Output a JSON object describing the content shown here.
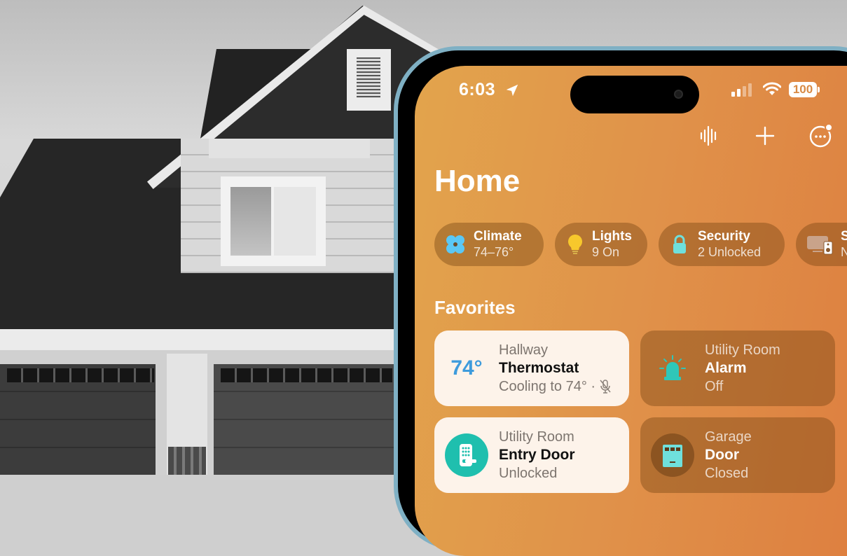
{
  "status_bar": {
    "time": "6:03",
    "battery": "100",
    "icons": [
      "location-arrow-icon",
      "cellular-signal-icon",
      "wifi-icon",
      "battery-icon"
    ]
  },
  "toolbar": {
    "icons": [
      "voice-waveform-icon",
      "add-icon",
      "more-options-icon"
    ]
  },
  "page": {
    "title": "Home"
  },
  "categories": [
    {
      "icon": "fan-icon",
      "label": "Climate",
      "value": "74–76°"
    },
    {
      "icon": "lightbulb-icon",
      "label": "Lights",
      "value": "9 On"
    },
    {
      "icon": "lock-icon",
      "label": "Security",
      "value": "2 Unlocked"
    },
    {
      "icon": "speaker-tv-icon",
      "label": "S",
      "value": "N"
    }
  ],
  "favorites": {
    "heading": "Favorites",
    "tiles": [
      {
        "lead": "74°",
        "room": "Hallway",
        "name": "Thermostat",
        "state": "Cooling to 74° ·",
        "icon": "mic-off-icon",
        "style": "light"
      },
      {
        "icon": "alarm-siren-icon",
        "room": "Utility Room",
        "name": "Alarm",
        "state": "Off",
        "style": "dark"
      },
      {
        "icon": "keypad-lock-icon",
        "room": "Utility Room",
        "name": "Entry Door",
        "state": "Unlocked",
        "style": "light"
      },
      {
        "icon": "garage-door-icon",
        "room": "Garage",
        "name": "Door",
        "state": "Closed",
        "style": "dark"
      }
    ]
  },
  "colors": {
    "accent_orange": "#e0924a",
    "thermostat_blue": "#3e9bdc",
    "teal": "#2ec4b6",
    "phone_frame": "#7fb0c4"
  }
}
